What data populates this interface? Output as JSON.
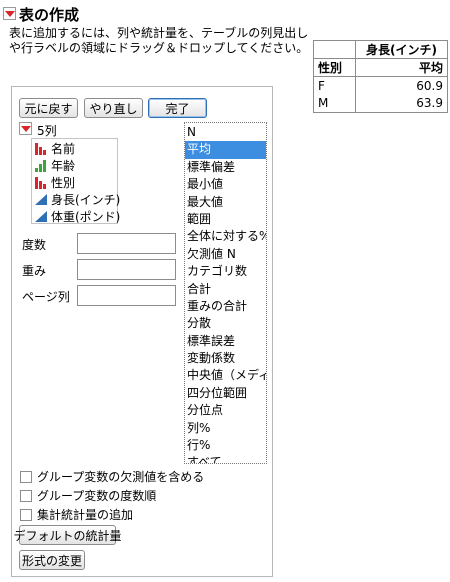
{
  "window": {
    "title": "表の作成"
  },
  "instructions": "表に追加するには、列や統計量を、テーブルの列見出しや行ラベルの領域にドラッグ＆ドロップしてください。",
  "toolbar": {
    "undo": "元に戻す",
    "redo": "やり直し",
    "done": "完了"
  },
  "columns": {
    "header": "5列",
    "items": [
      {
        "label": "名前",
        "icon": "nominal-bar-icon"
      },
      {
        "label": "年齢",
        "icon": "ordinal-bar-icon"
      },
      {
        "label": "性別",
        "icon": "nominal-bar-icon"
      },
      {
        "label": "身長(インチ)",
        "icon": "continuous-triangle-icon"
      },
      {
        "label": "体重(ポンド)",
        "icon": "continuous-triangle-icon"
      }
    ]
  },
  "roles": {
    "freq": "度数",
    "weight": "重み",
    "page": "ページ列"
  },
  "statistics": {
    "selected_index": 1,
    "items": [
      "N",
      "平均",
      "標準偏差",
      "最小値",
      "最大値",
      "範囲",
      "全体に対する%",
      "欠測値 N",
      "カテゴリ数",
      "合計",
      "重みの合計",
      "分散",
      "標準誤差",
      "変動係数",
      "中央値（メディアン）",
      "四分位範囲",
      "分位点",
      "列%",
      "行%",
      "すべて"
    ]
  },
  "options": {
    "include_missing": "グループ変数の欠測値を含める",
    "order_by_count": "グループ変数の度数順",
    "add_aggregate": "集計統計量の追加"
  },
  "buttons": {
    "default_stats": "デフォルトの統計量",
    "change_format": "形式の変更"
  },
  "output_table": {
    "column_header": "身長(インチ)",
    "row_header": "性別",
    "stat_header": "平均",
    "rows": [
      {
        "label": "F",
        "value": "60.9"
      },
      {
        "label": "M",
        "value": "63.9"
      }
    ]
  },
  "colors": {
    "accent_red": "#d8262b",
    "selection_blue": "#3d8ee0",
    "ordinal_green": "#3aa53a",
    "continuous_blue": "#2f6fb3"
  }
}
